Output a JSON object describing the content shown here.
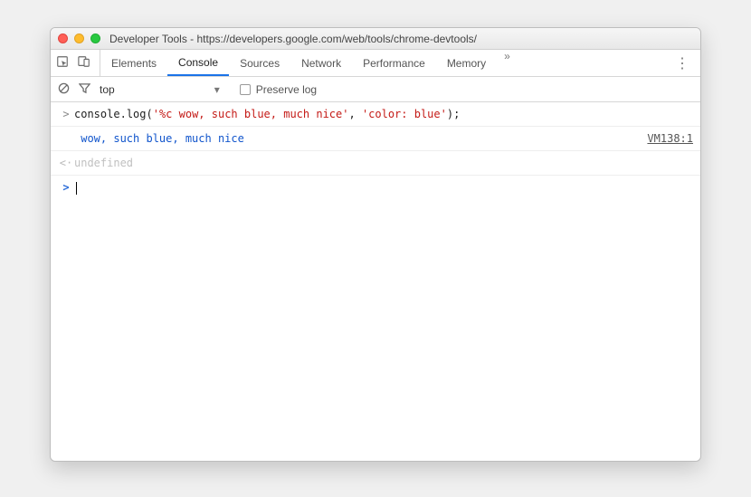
{
  "window": {
    "title": "Developer Tools - https://developers.google.com/web/tools/chrome-devtools/"
  },
  "tabs": {
    "items": [
      "Elements",
      "Console",
      "Sources",
      "Network",
      "Performance",
      "Memory"
    ],
    "active_index": 1,
    "overflow_glyph": "»"
  },
  "toolbar": {
    "context": "top",
    "preserve_label": "Preserve log",
    "preserve_checked": false
  },
  "console": {
    "input_line": {
      "prompt": ">",
      "code_pre": "console",
      "code_dot": ".",
      "code_method": "log",
      "code_open": "(",
      "code_str1": "'%c wow, such blue, much nice'",
      "code_comma": ", ",
      "code_str2": "'color: blue'",
      "code_close": ");"
    },
    "output_line": {
      "indicator": "",
      "text": " wow, such blue, much nice",
      "source": "VM138:1"
    },
    "return_line": {
      "indicator": "<·",
      "text": "undefined"
    },
    "prompt_line": {
      "indicator": ">"
    }
  }
}
